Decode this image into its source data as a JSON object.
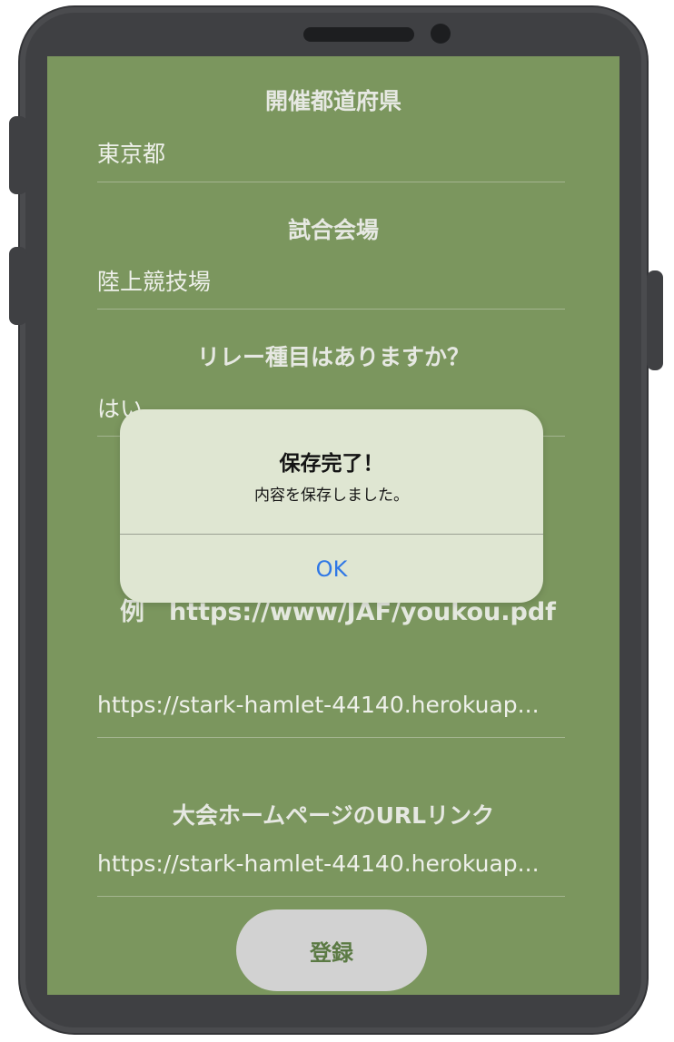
{
  "form": {
    "prefecture_title": "開催都道府県",
    "prefecture_value": "東京都",
    "venue_title": "試合会場",
    "venue_value": "陸上競技場",
    "relay_title": "リレー種目はありますか？",
    "relay_value": "はい",
    "example_text": "例　https://www/JAF/youkou.pdf",
    "guide_url_value": "https://stark-hamlet-44140.herokuap...",
    "homepage_title": "大会ホームページのURLリンク",
    "homepage_url_value": "https://stark-hamlet-44140.herokuap...",
    "register_label": "登録"
  },
  "alert": {
    "title": "保存完了！",
    "message": "内容を保存しました。",
    "ok_label": "OK"
  },
  "colors": {
    "screen_background": "#7b965e",
    "dialog_background": "#dfe6d2",
    "ok_link": "#2f78e6",
    "register_button": "#d2d2d2"
  }
}
